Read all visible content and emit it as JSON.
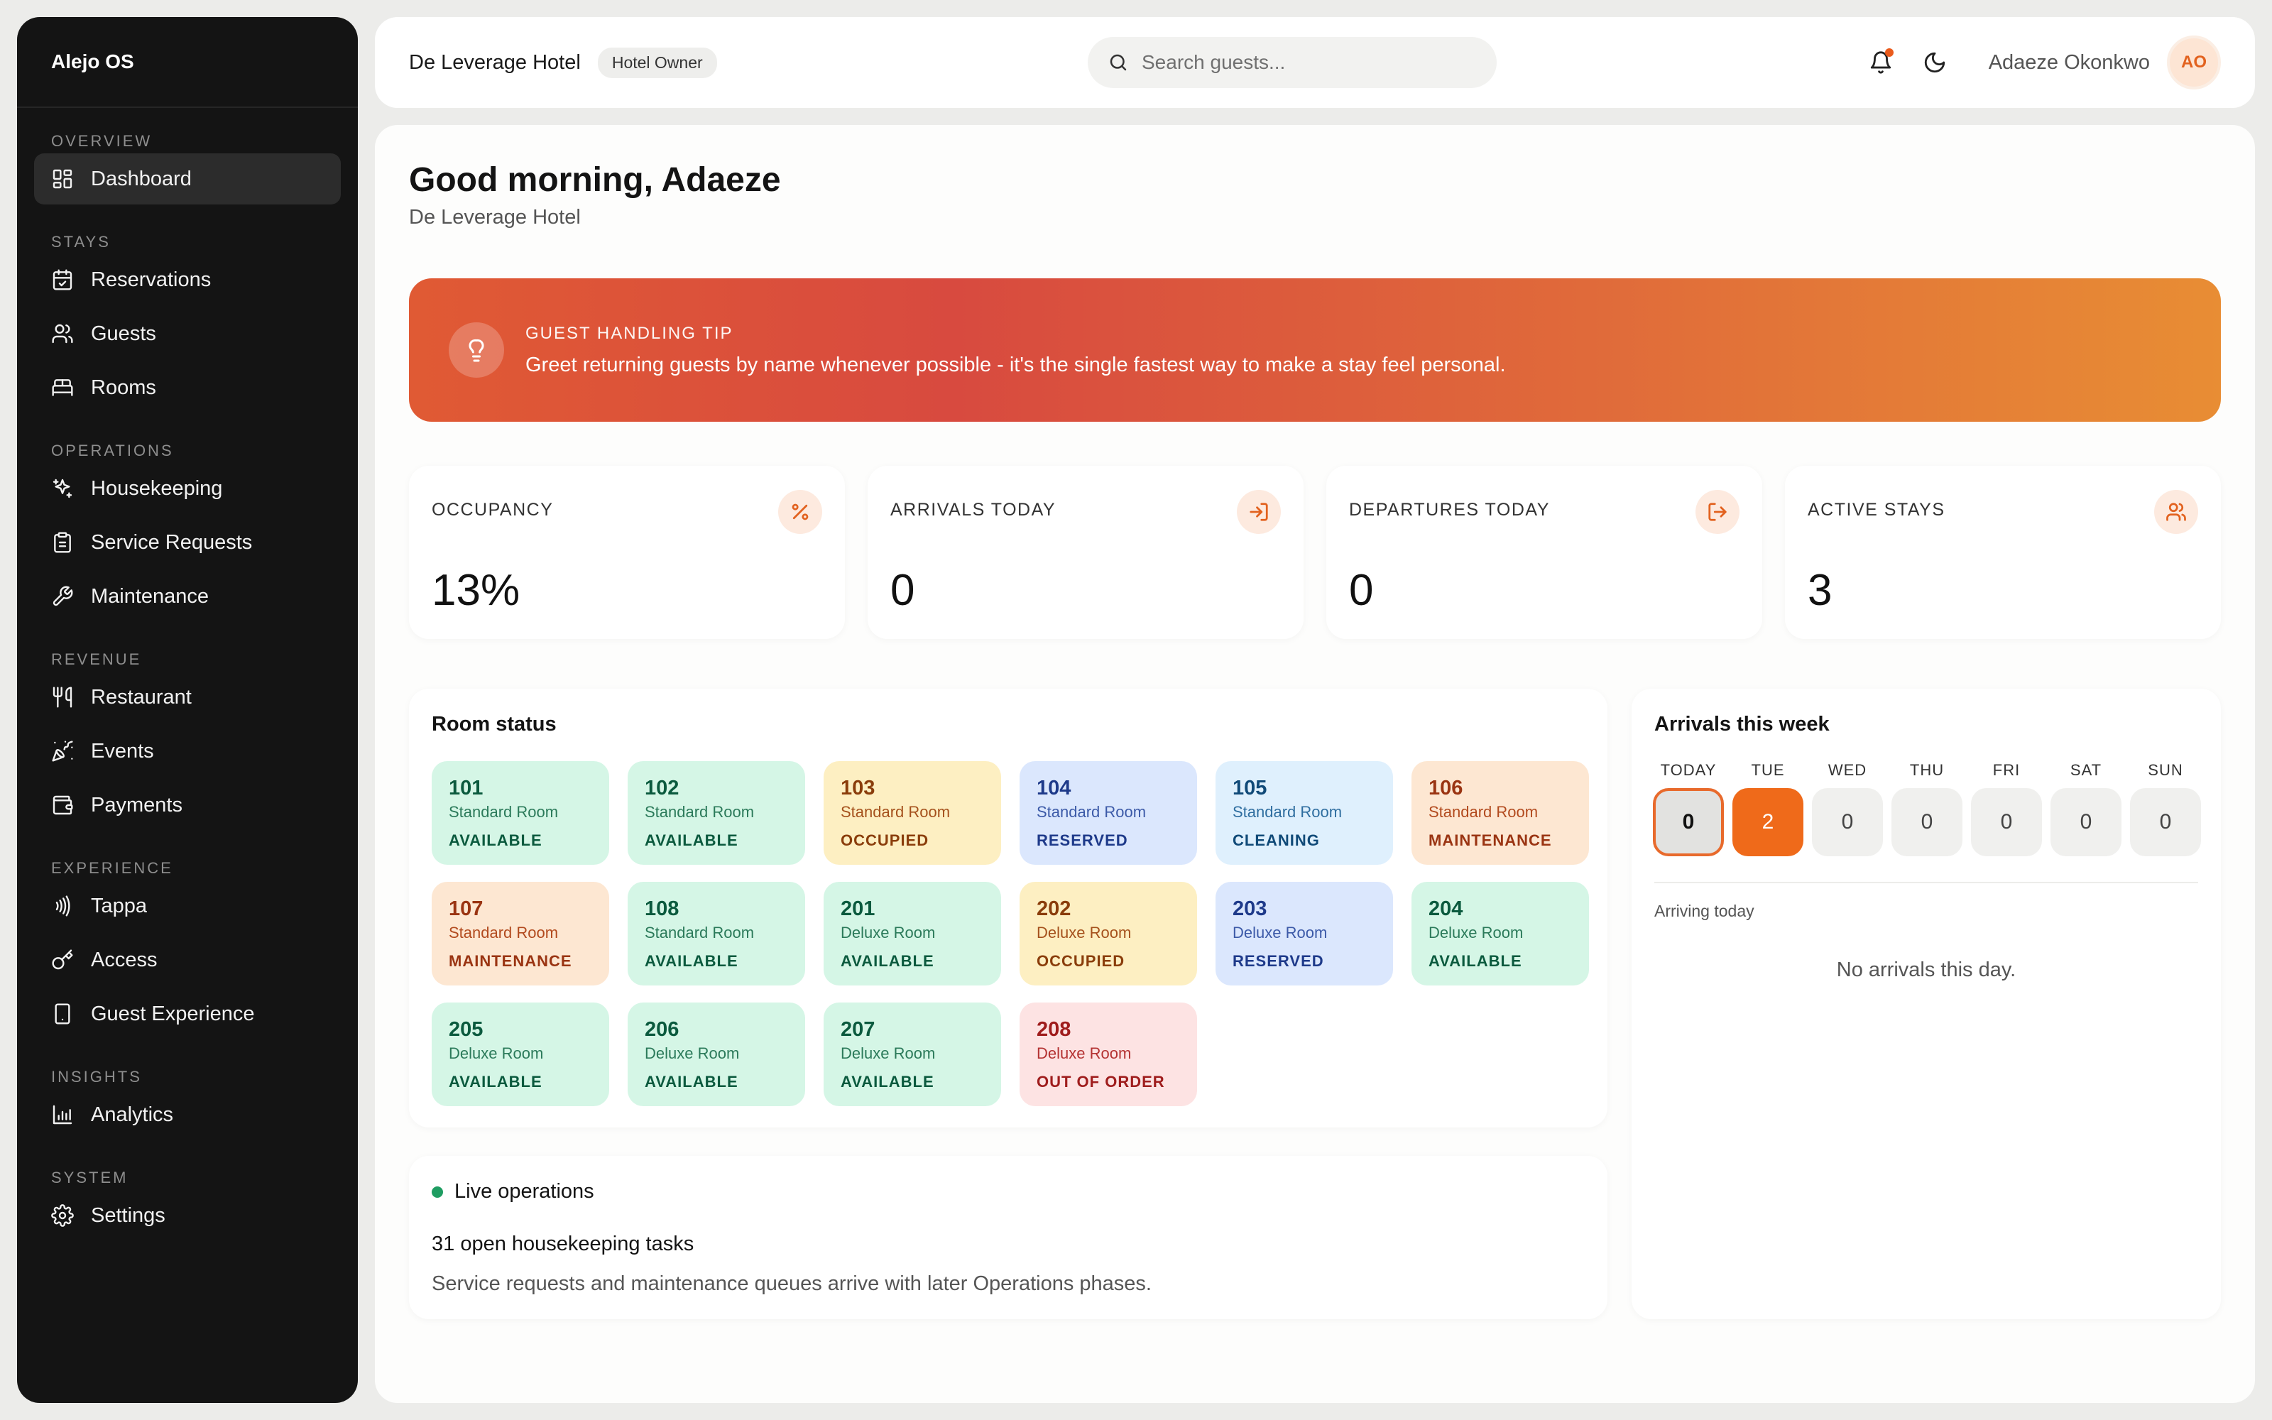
{
  "sidebar": {
    "brand": "Alejo OS",
    "sections": [
      {
        "title": "OVERVIEW",
        "items": [
          {
            "label": "Dashboard",
            "icon": "dashboard-icon",
            "active": true
          }
        ]
      },
      {
        "title": "STAYS",
        "items": [
          {
            "label": "Reservations",
            "icon": "calendar-icon"
          },
          {
            "label": "Guests",
            "icon": "users-icon"
          },
          {
            "label": "Rooms",
            "icon": "bed-icon"
          }
        ]
      },
      {
        "title": "OPERATIONS",
        "items": [
          {
            "label": "Housekeeping",
            "icon": "sparkles-icon"
          },
          {
            "label": "Service Requests",
            "icon": "clipboard-icon"
          },
          {
            "label": "Maintenance",
            "icon": "wrench-icon"
          }
        ]
      },
      {
        "title": "REVENUE",
        "items": [
          {
            "label": "Restaurant",
            "icon": "utensils-icon"
          },
          {
            "label": "Events",
            "icon": "party-icon"
          },
          {
            "label": "Payments",
            "icon": "wallet-icon"
          }
        ]
      },
      {
        "title": "EXPERIENCE",
        "items": [
          {
            "label": "Tappa",
            "icon": "nfc-icon"
          },
          {
            "label": "Access",
            "icon": "key-icon"
          },
          {
            "label": "Guest Experience",
            "icon": "phone-icon"
          }
        ]
      },
      {
        "title": "INSIGHTS",
        "items": [
          {
            "label": "Analytics",
            "icon": "bar-chart-icon"
          }
        ]
      },
      {
        "title": "SYSTEM",
        "items": [
          {
            "label": "Settings",
            "icon": "gear-icon"
          }
        ]
      }
    ]
  },
  "topbar": {
    "hotel": "De Leverage Hotel",
    "role": "Hotel Owner",
    "search_placeholder": "Search guests...",
    "user": "Adaeze Okonkwo",
    "initials": "AO"
  },
  "main": {
    "greeting": "Good morning, Adaeze",
    "hotel": "De Leverage Hotel",
    "tip": {
      "title": "GUEST HANDLING TIP",
      "text": "Greet returning guests by name whenever possible - it's the single fastest way to make a stay feel personal."
    },
    "stats": [
      {
        "label": "OCCUPANCY",
        "value": "13%",
        "icon": "percent-icon"
      },
      {
        "label": "ARRIVALS TODAY",
        "value": "0",
        "icon": "log-in-icon"
      },
      {
        "label": "DEPARTURES TODAY",
        "value": "0",
        "icon": "log-out-icon"
      },
      {
        "label": "ACTIVE STAYS",
        "value": "3",
        "icon": "users-icon"
      }
    ],
    "room_status": {
      "title": "Room status",
      "rooms": [
        {
          "num": "101",
          "type": "Standard Room",
          "status": "AVAILABLE",
          "kind": "available"
        },
        {
          "num": "102",
          "type": "Standard Room",
          "status": "AVAILABLE",
          "kind": "available"
        },
        {
          "num": "103",
          "type": "Standard Room",
          "status": "OCCUPIED",
          "kind": "occupied"
        },
        {
          "num": "104",
          "type": "Standard Room",
          "status": "RESERVED",
          "kind": "reserved"
        },
        {
          "num": "105",
          "type": "Standard Room",
          "status": "CLEANING",
          "kind": "cleaning"
        },
        {
          "num": "106",
          "type": "Standard Room",
          "status": "MAINTENANCE",
          "kind": "maintenance"
        },
        {
          "num": "107",
          "type": "Standard Room",
          "status": "MAINTENANCE",
          "kind": "maintenance"
        },
        {
          "num": "108",
          "type": "Standard Room",
          "status": "AVAILABLE",
          "kind": "available"
        },
        {
          "num": "201",
          "type": "Deluxe Room",
          "status": "AVAILABLE",
          "kind": "available"
        },
        {
          "num": "202",
          "type": "Deluxe Room",
          "status": "OCCUPIED",
          "kind": "occupied"
        },
        {
          "num": "203",
          "type": "Deluxe Room",
          "status": "RESERVED",
          "kind": "reserved"
        },
        {
          "num": "204",
          "type": "Deluxe Room",
          "status": "AVAILABLE",
          "kind": "available"
        },
        {
          "num": "205",
          "type": "Deluxe Room",
          "status": "AVAILABLE",
          "kind": "available"
        },
        {
          "num": "206",
          "type": "Deluxe Room",
          "status": "AVAILABLE",
          "kind": "available"
        },
        {
          "num": "207",
          "type": "Deluxe Room",
          "status": "AVAILABLE",
          "kind": "available"
        },
        {
          "num": "208",
          "type": "Deluxe Room",
          "status": "OUT OF ORDER",
          "kind": "outoforder"
        }
      ]
    },
    "live": {
      "title": "Live operations",
      "headline": "31 open housekeeping tasks",
      "text": "Service requests and maintenance queues arrive with later Operations phases."
    },
    "arrivals": {
      "title": "Arrivals this week",
      "days": [
        {
          "label": "TODAY",
          "count": "0",
          "state": "today"
        },
        {
          "label": "TUE",
          "count": "2",
          "state": "hot"
        },
        {
          "label": "WED",
          "count": "0",
          "state": ""
        },
        {
          "label": "THU",
          "count": "0",
          "state": ""
        },
        {
          "label": "FRI",
          "count": "0",
          "state": ""
        },
        {
          "label": "SAT",
          "count": "0",
          "state": ""
        },
        {
          "label": "SUN",
          "count": "0",
          "state": ""
        }
      ],
      "sub": "Arriving today",
      "empty": "No arrivals this day."
    }
  },
  "colors": {
    "accent": "#ef6a1a",
    "sidebar": "#141414",
    "live_dot": "#1f9d62"
  }
}
